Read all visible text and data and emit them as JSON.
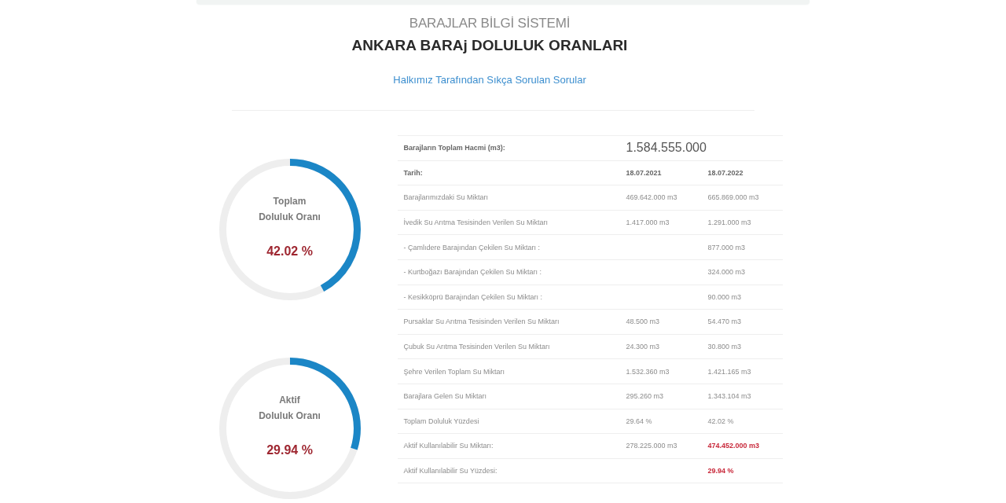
{
  "header": {
    "system_title": "BARAJLAR BİLGİ SİSTEMİ",
    "page_title": "ANKARA BARAj DOLULUK ORANLARI",
    "faq_link": "Halkımız Tarafından Sıkça Sorulan Sorular"
  },
  "gauges": [
    {
      "label": "Toplam\nDoluluk Oranı",
      "value": "42.02 %",
      "level": 0.4202
    },
    {
      "label": "Aktif\nDoluluk Oranı",
      "value": "29.94 %",
      "level": 0.2994
    }
  ],
  "table": {
    "total_volume": {
      "label": "Barajların Toplam Hacmi (m3):",
      "value": "1.584.555.000"
    },
    "columns": [
      "Tarih:",
      "18.07.2021",
      "18.07.2022"
    ],
    "rows": [
      {
        "label": "Barajlarımızdaki Su Miktarı",
        "value_1": {
          "text": "469.642.000 m3",
          "highlighted": false
        },
        "value_2": {
          "text": "665.869.000 m3",
          "highlighted": false
        }
      },
      {
        "label": "İvedik Su Arıtma Tesisinden Verilen Su Miktarı",
        "value_1": {
          "text": "1.417.000 m3",
          "highlighted": false
        },
        "value_2": {
          "text": "1.291.000 m3",
          "highlighted": false
        }
      },
      {
        "label": "- Çamlıdere Barajından Çekilen Su Miktarı :",
        "value_2": {
          "text": "877.000 m3",
          "highlighted": false
        }
      },
      {
        "label": "- Kurtboğazı Barajından Çekilen Su Miktarı :",
        "value_2": {
          "text": "324.000 m3",
          "highlighted": false
        }
      },
      {
        "label": "- Kesikköprü Barajından Çekilen Su Miktarı :",
        "value_2": {
          "text": "90.000 m3",
          "highlighted": false
        }
      },
      {
        "label": "Pursaklar Su Arıtma Tesisinden Verilen Su Miktarı",
        "value_1": {
          "text": "48.500 m3",
          "highlighted": false
        },
        "value_2": {
          "text": "54.470 m3",
          "highlighted": false
        }
      },
      {
        "label": "Çubuk Su Arıtma Tesisinden Verilen Su Miktarı",
        "value_1": {
          "text": "24.300 m3",
          "highlighted": false
        },
        "value_2": {
          "text": "30.800 m3",
          "highlighted": false
        }
      },
      {
        "label": "Şehre Verilen Toplam Su Miktarı",
        "value_1": {
          "text": "1.532.360 m3",
          "highlighted": false
        },
        "value_2": {
          "text": "1.421.165 m3",
          "highlighted": false
        }
      },
      {
        "label": "Barajlara Gelen Su Miktarı",
        "value_1": {
          "text": "295.260 m3",
          "highlighted": false
        },
        "value_2": {
          "text": "1.343.104 m3",
          "highlighted": false
        }
      },
      {
        "label": "Toplam Doluluk Yüzdesi",
        "value_1": {
          "text": "29.64 %",
          "highlighted": false
        },
        "value_2": {
          "text": "42.02 %",
          "highlighted": false
        }
      },
      {
        "label": "Aktif Kullanılabilir Su Miktarı:",
        "value_1": {
          "text": "278.225.000 m3",
          "highlighted": false
        },
        "value_2": {
          "text": "474.452.000 m3",
          "highlighted": true
        }
      },
      {
        "label": "Aktif Kullanılabilir Su Yüzdesi:",
        "value_2": {
          "text": "29.94 %",
          "highlighted": true
        }
      }
    ]
  }
}
